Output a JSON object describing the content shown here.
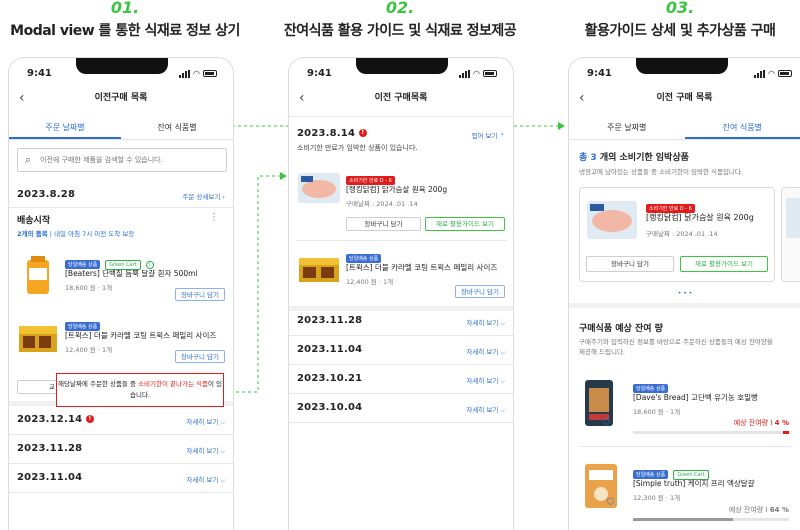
{
  "steps": [
    {
      "num": "01.",
      "title": "Modal view 를 통한 식재료 정보 상기"
    },
    {
      "num": "02.",
      "title": "잔여식품 활용 가이드 및 식재료 정보제공"
    },
    {
      "num": "03.",
      "title": "활용가이드 상세 및 추가상품 구매"
    }
  ],
  "status_time": "9:41",
  "icons": {
    "back": "chevron-left-icon",
    "search": "search-icon",
    "info": "info-icon",
    "alert": "alert-icon",
    "cart": "cart-icon",
    "more": "more-vertical-icon"
  },
  "colors": {
    "accent": "#2b6fd6",
    "green": "#3cc442",
    "red": "#e21b1b"
  },
  "phone1": {
    "title": "이전구매 목록",
    "tabs": [
      "주문 날짜별",
      "잔여 식품별"
    ],
    "search_placeholder": "이전에 구매한 제품을 검색할 수 있습니다.",
    "date": "2023.8.28",
    "detail_link": "주문 상세보기",
    "ship_title": "배송시작",
    "ship_count": "2개의 품목",
    "ship_sub": "내일 아침 7시 이전 도착 보장",
    "items": [
      {
        "chip": "당일배송 상품",
        "chip2": "Green Cart",
        "name": "[Beaters] 단백질 듬뿍 달걀 흰자 500ml",
        "price": "18,600 원",
        "qty": "1개",
        "btn": "장바구니 담기"
      },
      {
        "chip": "당일배송 상품",
        "name": "[트윅스] 더블 카라멜 코팅 트윅스 페밀리 사이즈",
        "price": "12,400 원",
        "qty": "1개",
        "btn": "장바구니 담기"
      }
    ],
    "partial_btn": "교",
    "tooltip_pre": "해당날짜에 주문한 상품들 중 ",
    "tooltip_red": "소비기한이 끝나가는 식품",
    "tooltip_post": "이 있습니다.",
    "rows": [
      {
        "date": "2023.12.14",
        "more": "자세히 보기"
      },
      {
        "date": "2023.11.28",
        "more": "자세히 보기"
      },
      {
        "date": "2023.11.04",
        "more": "자세히 보기"
      }
    ]
  },
  "phone2": {
    "title": "이전 구매목록",
    "date": "2023.8.14",
    "fold": "접어 보기",
    "notice": "소비기한 만료가 임박한 상품이 있습니다.",
    "item1": {
      "badge": "소비기한 만료 D - 6",
      "name": "[랭킹닭컴] 닭가슴살 원육 200g",
      "purchase": "구매날짜 : 2024 .01 .14",
      "btn_cart": "장바구니 담기",
      "btn_guide": "재료 활용가이드 보기"
    },
    "item2": {
      "chip": "당일배송 상품",
      "name": "[트윅스] 더블 카라멜 코팅 트윅스 페밀리 사이즈",
      "price": "12,400 원",
      "qty": "1개",
      "btn": "장바구니 담기"
    },
    "rows": [
      {
        "date": "2023.11.28",
        "more": "자세히 보기"
      },
      {
        "date": "2023.11.04",
        "more": "자세히 보기"
      },
      {
        "date": "2023.10.21",
        "more": "자세히 보기"
      },
      {
        "date": "2023.10.04",
        "more": "자세히 보기"
      }
    ]
  },
  "phone3": {
    "title": "이전 구매 목록",
    "tabs": [
      "주문 날짜별",
      "잔여 식품별"
    ],
    "head_pre": "총 ",
    "head_num": "3",
    "head_post": " 개의 소비기한 임박상품",
    "sub": "냉장고에 남아있는 상품들 중 소비기한이 임박한 식품입니다.",
    "card": {
      "badge": "소비기한 만료 D - 6",
      "name": "[랭킹닭컴] 닭가슴살 원육 200g",
      "purchase": "구매날짜 : 2024 .01 .14",
      "btn_cart": "장바구니 담기",
      "btn_guide": "재료 활용가이드 보기"
    },
    "page_dots": "• • •",
    "section_title": "구매식품 예상 잔여 량",
    "section_sub": "구매주기와 입력하신 정보를 바탕으로 주문하신 상품들의 예상 잔여양을 제공해 드립니다.",
    "products": [
      {
        "chip": "당일배송 상품",
        "name": "[Dave's Bread] 고단백 유기농 호밀빵",
        "price": "18,600 원",
        "qty": "1개",
        "label": "예상 잔여량",
        "sep": "I",
        "percent": "4 %",
        "remaining": 0.04
      },
      {
        "chip": "당일배송 상품",
        "chip2": "Green Cart",
        "name": "[Simple truth] 케이지 프리 액상달걀",
        "price": "12,300 원",
        "qty": "1개",
        "label": "예상 잔여량",
        "sep": "I",
        "percent": "64 %",
        "remaining": 0.64
      }
    ]
  }
}
